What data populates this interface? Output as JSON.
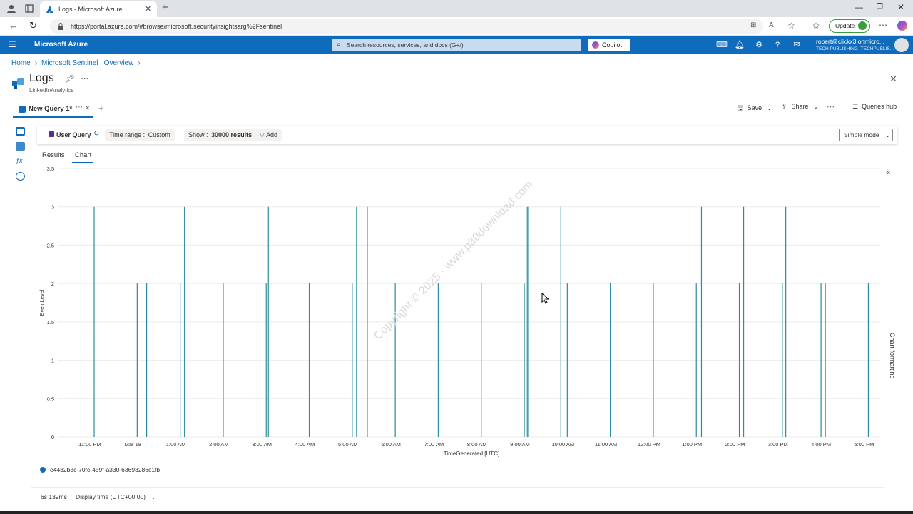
{
  "browser": {
    "tab_title": "Logs - Microsoft Azure",
    "url": "https://portal.azure.com/#browse/microsoft.securityinsightsarg%2Fsentinel",
    "update_label": "Update"
  },
  "azure": {
    "brand": "Microsoft Azure",
    "search_placeholder": "Search resources, services, and docs (G+/)",
    "copilot_label": "Copilot",
    "account_name": "robert@clickx3.onmicro...",
    "account_org": "TECH PUBLISHING (TECHPUBLIS..."
  },
  "breadcrumb": [
    "Home",
    "Microsoft Sentinel | Overview"
  ],
  "page": {
    "title": "Logs",
    "subtitle": "LinkedInAnalytics"
  },
  "query_tab": {
    "label": "New Query 1*"
  },
  "toolbar": {
    "save": "Save",
    "share": "Share",
    "queries_hub": "Queries hub"
  },
  "querybar": {
    "user_query": "User Query",
    "time_range_label": "Time range :",
    "time_range_value": "Custom",
    "show_label": "Show :",
    "show_value": "30000 results",
    "add_label": "Add",
    "mode": "Simple mode"
  },
  "result_tabs": {
    "results": "Results",
    "chart": "Chart"
  },
  "side_panel": {
    "label": "Chart formatting"
  },
  "footer": {
    "duration": "6s 139ms",
    "display_time": "Display time (UTC+00:00)"
  },
  "watermark": "Copyright © 2025 - www.p30download.com",
  "colors": {
    "azure_blue": "#0f6cbd",
    "series": "#2a8c9c"
  },
  "chart_data": {
    "type": "bar",
    "xlabel": "TimeGenerated [UTC]",
    "ylabel": "EventLevel",
    "ylim": [
      0,
      3.5
    ],
    "yticks": [
      0,
      0.5,
      1,
      1.5,
      2,
      2.5,
      3,
      3.5
    ],
    "xticks": [
      "11:00 PM",
      "Mar 18",
      "1:00 AM",
      "2:00 AM",
      "3:00 AM",
      "4:00 AM",
      "5:00 AM",
      "6:00 AM",
      "7:00 AM",
      "8:00 AM",
      "9:00 AM",
      "10:00 AM",
      "11:00 AM",
      "12:00 PM",
      "1:00 PM",
      "2:00 PM",
      "3:00 PM",
      "4:00 PM",
      "5:00 PM"
    ],
    "x_unit": "hours after 11:00 PM",
    "series": [
      {
        "name": "e4432b3c-70fc-459f-a330-63693286c1fb",
        "points": [
          {
            "x": 0.1,
            "y": 3
          },
          {
            "x": 1.1,
            "y": 2
          },
          {
            "x": 1.32,
            "y": 2
          },
          {
            "x": 2.1,
            "y": 2
          },
          {
            "x": 2.2,
            "y": 3
          },
          {
            "x": 3.1,
            "y": 2
          },
          {
            "x": 4.1,
            "y": 2
          },
          {
            "x": 4.15,
            "y": 3
          },
          {
            "x": 5.1,
            "y": 2
          },
          {
            "x": 6.1,
            "y": 2
          },
          {
            "x": 6.2,
            "y": 3
          },
          {
            "x": 6.45,
            "y": 3
          },
          {
            "x": 7.1,
            "y": 2
          },
          {
            "x": 8.1,
            "y": 2
          },
          {
            "x": 9.1,
            "y": 2
          },
          {
            "x": 10.1,
            "y": 2
          },
          {
            "x": 10.17,
            "y": 3
          },
          {
            "x": 10.2,
            "y": 3
          },
          {
            "x": 10.95,
            "y": 3
          },
          {
            "x": 11.1,
            "y": 2
          },
          {
            "x": 12.1,
            "y": 2
          },
          {
            "x": 13.1,
            "y": 2
          },
          {
            "x": 14.1,
            "y": 2
          },
          {
            "x": 14.22,
            "y": 3
          },
          {
            "x": 15.1,
            "y": 2
          },
          {
            "x": 15.2,
            "y": 3
          },
          {
            "x": 16.1,
            "y": 2
          },
          {
            "x": 16.18,
            "y": 3
          },
          {
            "x": 17.0,
            "y": 2
          },
          {
            "x": 17.1,
            "y": 2
          },
          {
            "x": 18.1,
            "y": 2
          }
        ]
      }
    ],
    "grid": true,
    "legend": "bottom-left"
  }
}
